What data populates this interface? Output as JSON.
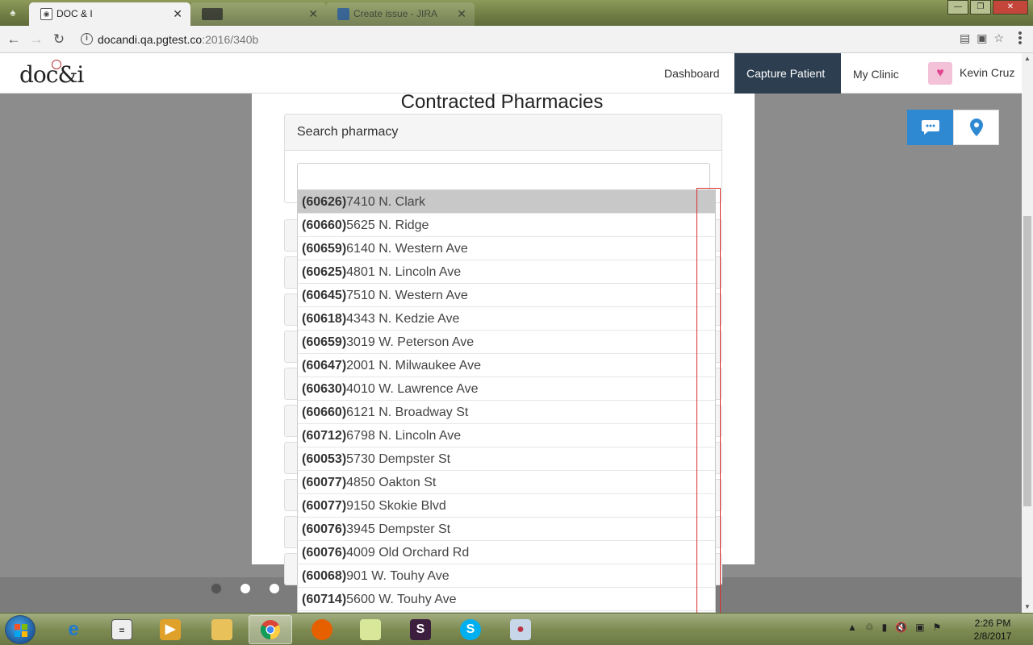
{
  "browser": {
    "tabs": [
      {
        "title": "DOC & I",
        "active": true
      },
      {
        "title": "",
        "active": false
      },
      {
        "title": "Create issue - JIRA",
        "active": false
      }
    ],
    "address": {
      "host": "docandi.qa.pgtest.co",
      "rest": ":2016/340b"
    }
  },
  "header": {
    "logo": "doc&i",
    "nav": [
      "Dashboard",
      "Capture Patient",
      "My Clinic"
    ],
    "active_nav": "Capture Patient",
    "user_name": "Kevin Cruz"
  },
  "modal": {
    "title": "Contracted Pharmacies",
    "search_label": "Search pharmacy",
    "search_value": ""
  },
  "pharmacies": [
    {
      "zip": "(60626)",
      "address": "7410 N. Clark",
      "highlighted": true
    },
    {
      "zip": "(60660)",
      "address": "5625 N. Ridge"
    },
    {
      "zip": "(60659)",
      "address": "6140 N. Western Ave"
    },
    {
      "zip": "(60625)",
      "address": "4801 N. Lincoln Ave"
    },
    {
      "zip": "(60645)",
      "address": "7510 N. Western Ave"
    },
    {
      "zip": "(60618)",
      "address": "4343 N. Kedzie Ave"
    },
    {
      "zip": "(60659)",
      "address": "3019 W. Peterson Ave"
    },
    {
      "zip": "(60647)",
      "address": "2001 N. Milwaukee Ave"
    },
    {
      "zip": "(60630)",
      "address": "4010 W. Lawrence Ave"
    },
    {
      "zip": "(60660)",
      "address": "6121 N. Broadway St"
    },
    {
      "zip": "(60712)",
      "address": "6798 N. Lincoln Ave"
    },
    {
      "zip": "(60053)",
      "address": "5730 Dempster St"
    },
    {
      "zip": "(60077)",
      "address": "4850 Oakton St"
    },
    {
      "zip": "(60077)",
      "address": "9150 Skokie Blvd"
    },
    {
      "zip": "(60076)",
      "address": "3945 Dempster St"
    },
    {
      "zip": "(60076)",
      "address": "4009 Old Orchard Rd"
    },
    {
      "zip": "(60068)",
      "address": "901 W. Touhy Ave"
    },
    {
      "zip": "(60714)",
      "address": "5600 W. Touhy Ave"
    }
  ],
  "carousel": {
    "count": 3,
    "active_index": 0
  },
  "taskbar": {
    "apps": [
      "internet-explorer",
      "calculator",
      "media-player",
      "file-explorer",
      "chrome",
      "firefox",
      "sticky-notes",
      "slack",
      "skype",
      "paint"
    ],
    "active_app": "chrome",
    "time": "2:26 PM",
    "date": "2/8/2017"
  },
  "colors": {
    "nav_active_bg": "#2c3e50",
    "chat_button": "#2f88d2",
    "highlight_row": "#c8c8c8",
    "outline": "#d9302c"
  }
}
